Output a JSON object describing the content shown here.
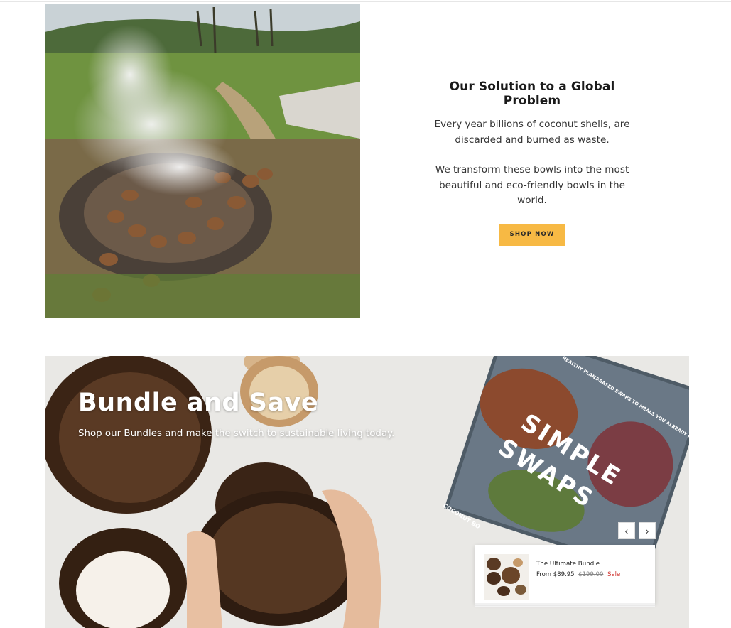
{
  "solution": {
    "title": "Our Solution to a Global Problem",
    "paragraph_1": "Every year billions of coconut shells, are discarded and burned as waste.",
    "paragraph_2": "We transform these bowls into the most beautiful and eco-friendly bowls in the world.",
    "button_label": "SHOP NOW",
    "button_color": "#f7b944"
  },
  "bundle": {
    "title": "Bundle and Save",
    "subtitle": "Shop our Bundles and make the switch to sustainable living today.",
    "book_title_line1": "SIMPLE",
    "book_title_line2": "SWAPS",
    "book_tagline": "HEALTHY PLANT-BASED SWAPS TO MEALS YOU ALREADY KNOW AND LOVE",
    "book_brand": "COCONUT BO",
    "carousel": {
      "prev_icon": "chevron-left-icon",
      "next_icon": "chevron-right-icon",
      "prev_glyph": "‹",
      "next_glyph": "›"
    },
    "product": {
      "name": "The Ultimate Bundle",
      "price_prefix": "From",
      "price": "$89.95",
      "compare_price": "$199.00",
      "sale_label": "Sale",
      "sale_color": "#d0312d"
    }
  }
}
